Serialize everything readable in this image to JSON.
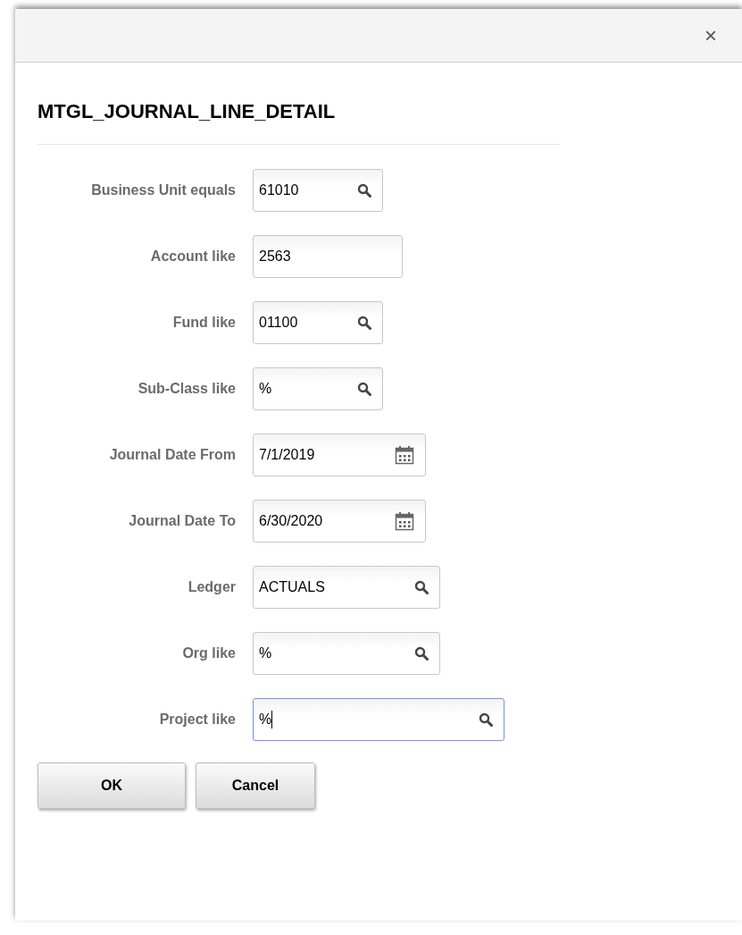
{
  "dialog": {
    "close": "×",
    "title": "MTGL_JOURNAL_LINE_DETAIL"
  },
  "fields": [
    {
      "label": "Business Unit equals",
      "value": "61010",
      "kind": "lookup",
      "focused": false
    },
    {
      "label": "Account like",
      "value": "2563",
      "kind": "text",
      "focused": false
    },
    {
      "label": "Fund like",
      "value": "01100",
      "kind": "lookup",
      "focused": false
    },
    {
      "label": "Sub-Class like",
      "value": "%",
      "kind": "lookup",
      "focused": false
    },
    {
      "label": "Journal Date From",
      "value": "7/1/2019",
      "kind": "date",
      "focused": false
    },
    {
      "label": "Journal Date To",
      "value": "6/30/2020",
      "kind": "date",
      "focused": false
    },
    {
      "label": "Ledger",
      "value": "ACTUALS",
      "kind": "lookup",
      "focused": false
    },
    {
      "label": "Org like",
      "value": "%",
      "kind": "lookup",
      "focused": false
    },
    {
      "label": "Project like",
      "value": "%",
      "kind": "lookup",
      "focused": true
    }
  ],
  "buttons": [
    "OK",
    "Cancel"
  ]
}
